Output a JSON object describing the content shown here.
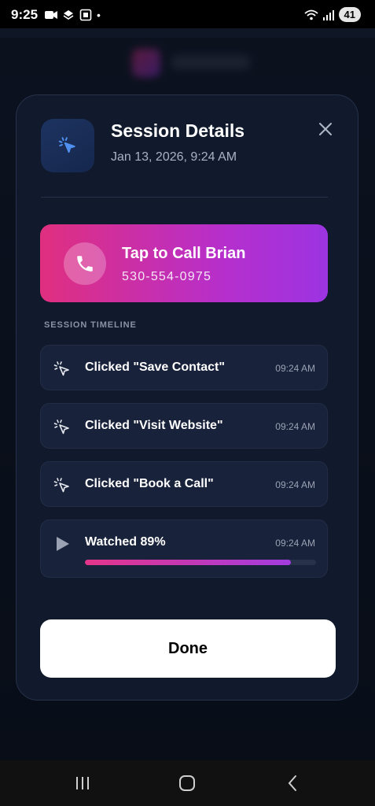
{
  "status_bar": {
    "time": "9:25",
    "battery": "41",
    "dot": "•"
  },
  "modal": {
    "title": "Session Details",
    "date": "Jan 13, 2026, 9:24 AM",
    "header_icon": "cursor-click-icon",
    "close_icon": "close-icon"
  },
  "call_card": {
    "title": "Tap to Call Brian",
    "phone": "530-554-0975",
    "icon": "phone-icon"
  },
  "timeline": {
    "label": "SESSION TIMELINE",
    "items": [
      {
        "text": "Clicked \"Save Contact\"",
        "time": "09:24 AM",
        "icon": "cursor-click-icon"
      },
      {
        "text": "Clicked \"Visit Website\"",
        "time": "09:24 AM",
        "icon": "cursor-click-icon"
      },
      {
        "text": "Clicked \"Book a Call\"",
        "time": "09:24 AM",
        "icon": "cursor-click-icon"
      },
      {
        "text": "Watched 89%",
        "time": "09:24 AM",
        "icon": "play-icon",
        "progress": 0.89
      }
    ]
  },
  "done_label": "Done",
  "colors": {
    "accent_pink": "#e02f7f",
    "accent_purple": "#9c34e2",
    "modal_bg": "#101a2c"
  }
}
